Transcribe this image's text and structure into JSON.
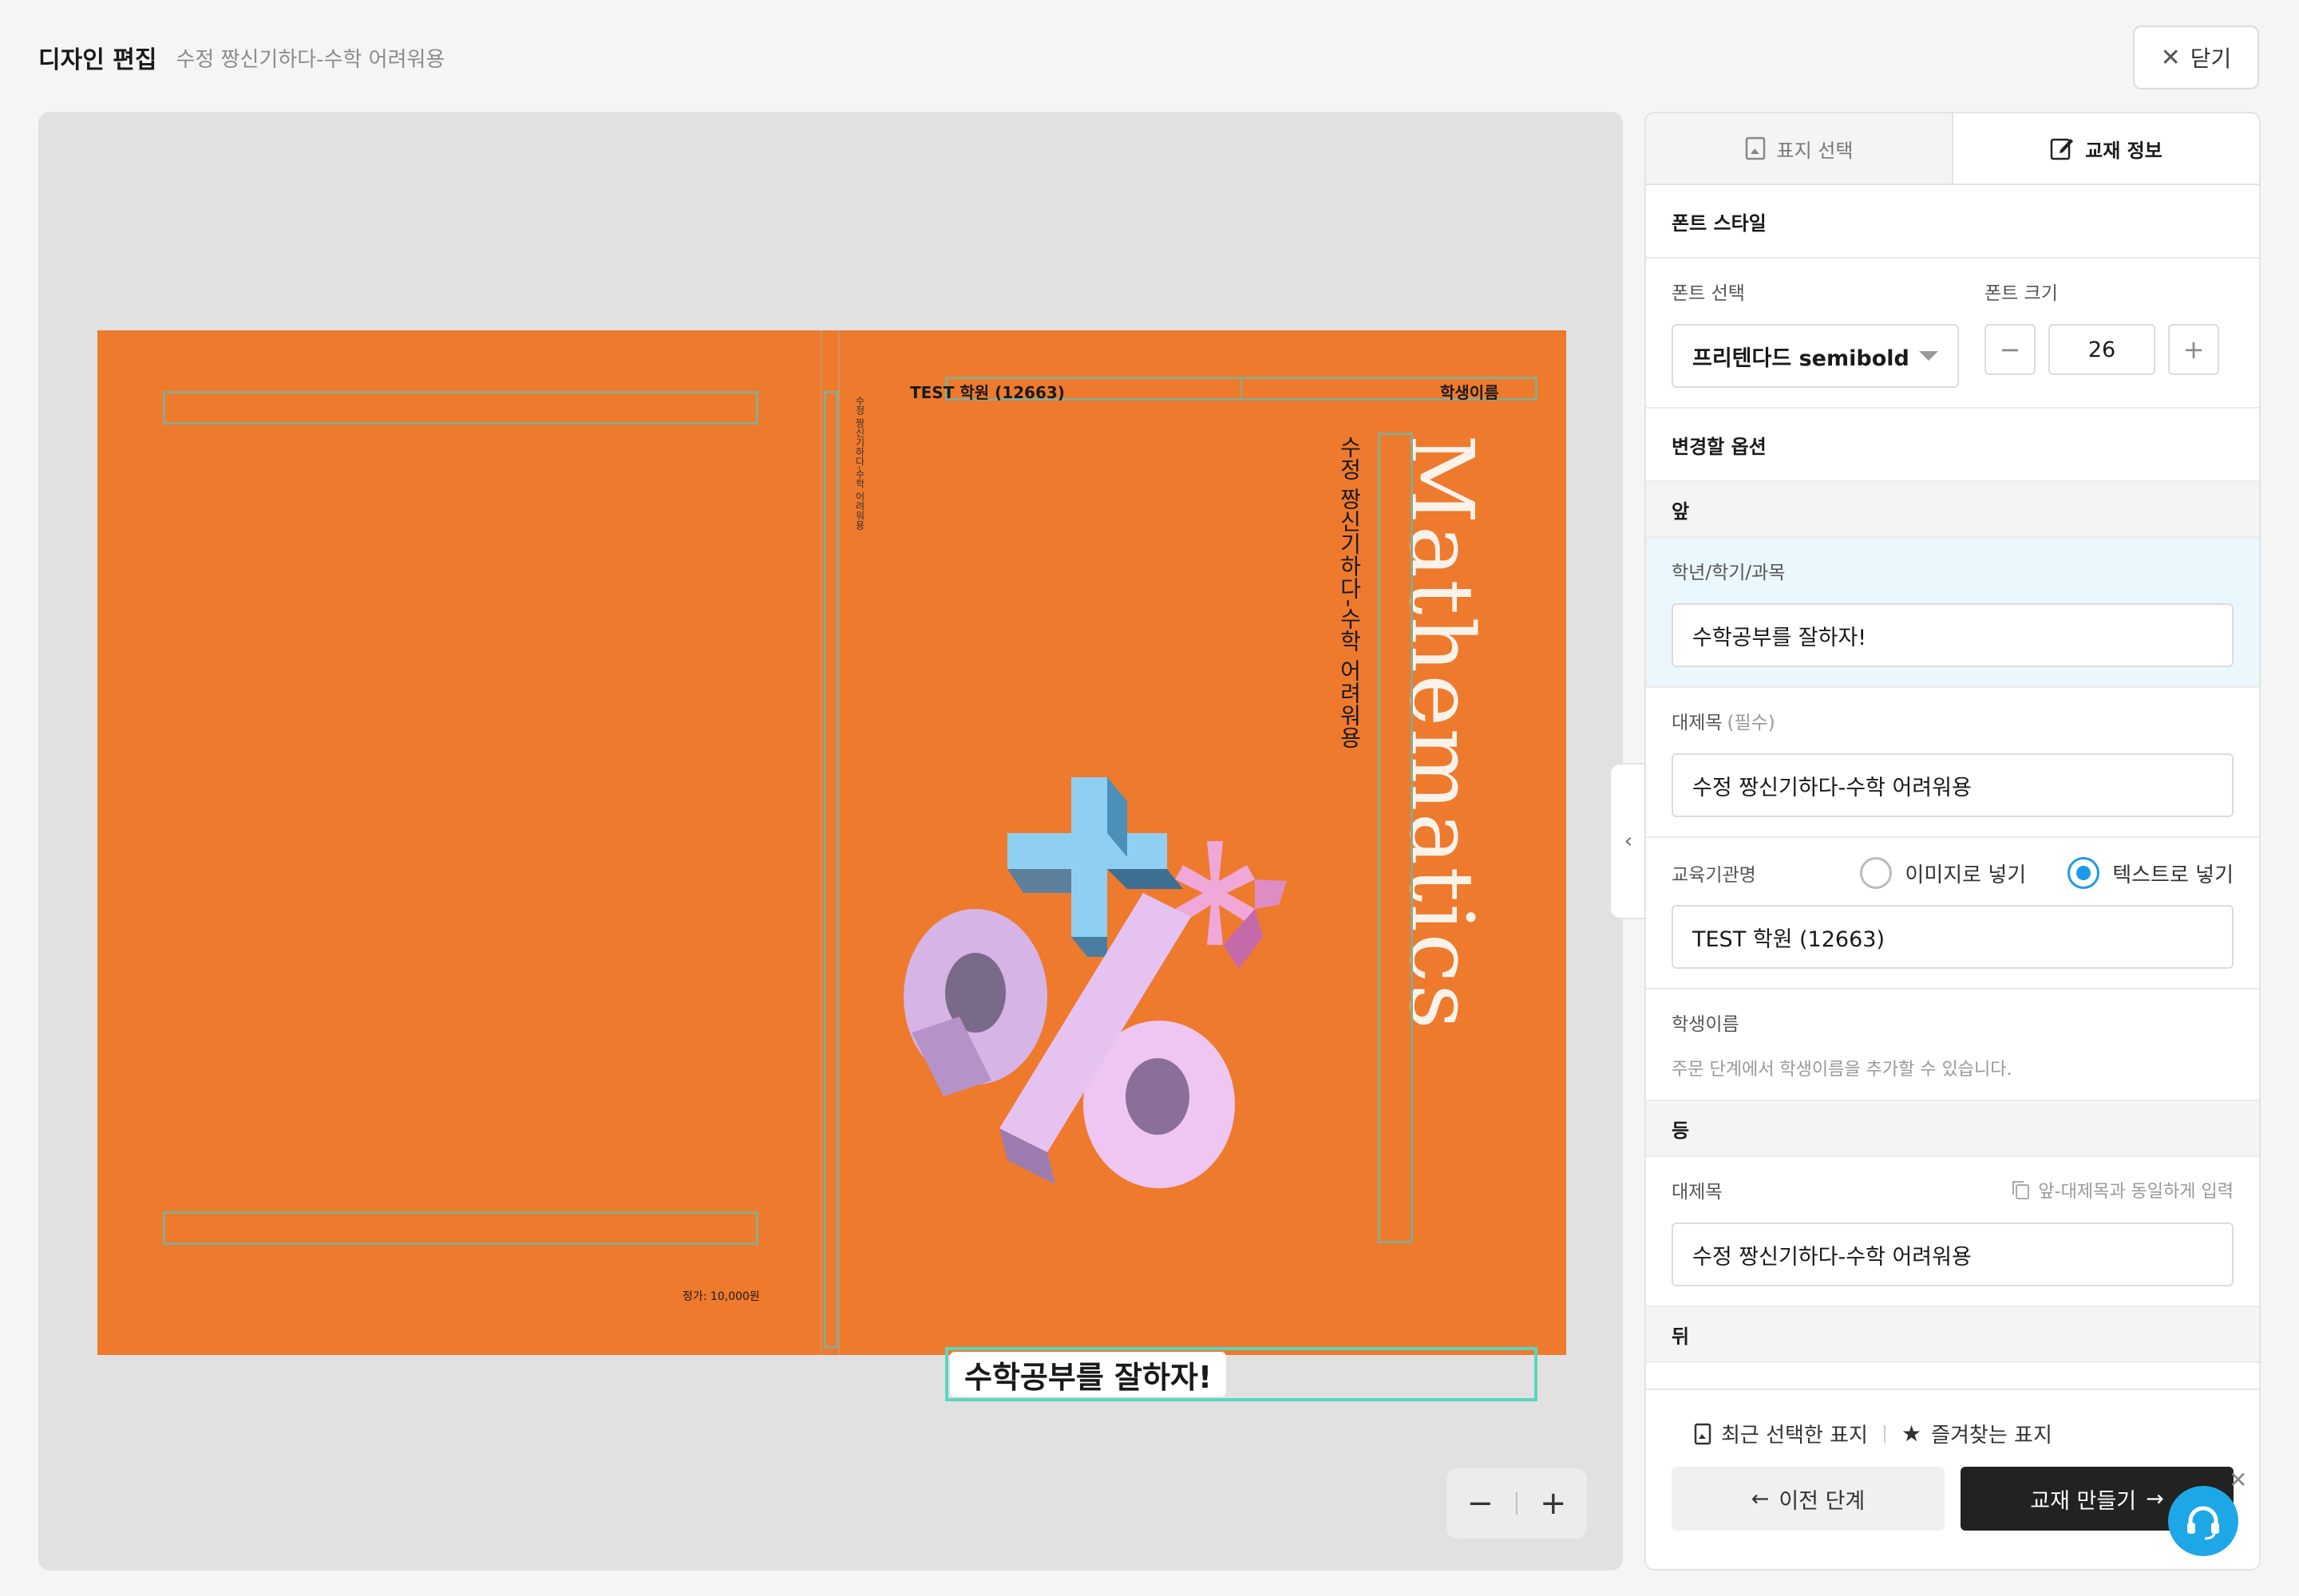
{
  "header": {
    "title": "디자인 편집",
    "subtitle": "수정 짱신기하다-수학 어려워용",
    "close_label": "닫기"
  },
  "cover": {
    "spine_text": "수정 짱신기하다-수학 어려워용",
    "price": "정가: 10,000원",
    "institution": "TEST 학원 (12663)",
    "student": "학생이름",
    "word": "Mathematics",
    "title_vertical": "수정 짱신기하다-수학 어려워용",
    "subject": "수학공부를 잘하자!"
  },
  "zoom": {
    "out": "−",
    "in": "+"
  },
  "panel": {
    "tabs": [
      {
        "label": "표지 선택"
      },
      {
        "label": "교재 정보"
      }
    ],
    "font_style": {
      "heading": "폰트 스타일",
      "font_label": "폰트 선택",
      "font_value": "프리텐다드 semibold",
      "size_label": "폰트 크기",
      "size_value": "26"
    },
    "options_heading": "변경할 옵션",
    "front": {
      "heading": "앞",
      "grade_label": "학년/학기/과목",
      "grade_value": "수학공부를 잘하자!",
      "title_label": "대제목",
      "title_required": "(필수)",
      "title_value": "수정 짱신기하다-수학 어려워용",
      "inst_label": "교육기관명",
      "inst_radio_image": "이미지로 넣기",
      "inst_radio_text": "텍스트로 넣기",
      "inst_value": "TEST 학원 (12663)",
      "student_label": "학생이름",
      "student_hint": "주문 단계에서 학생이름을 추가할 수 있습니다."
    },
    "spine": {
      "heading": "등",
      "title_label": "대제목",
      "copy_link": "앞-대제목과 동일하게 입력",
      "title_value": "수정 짱신기하다-수학 어려워용"
    },
    "back": {
      "heading": "뒤"
    },
    "footer": {
      "recent": "최근 선택한 표지",
      "favorites": "즐겨찾는 표지",
      "prev": "이전 단계",
      "next": "교재 만들기"
    }
  },
  "colors": {
    "cover_orange": "#ee7a2e",
    "accent_blue": "#1e9be6",
    "highlight_bg": "#eaf7fc"
  }
}
